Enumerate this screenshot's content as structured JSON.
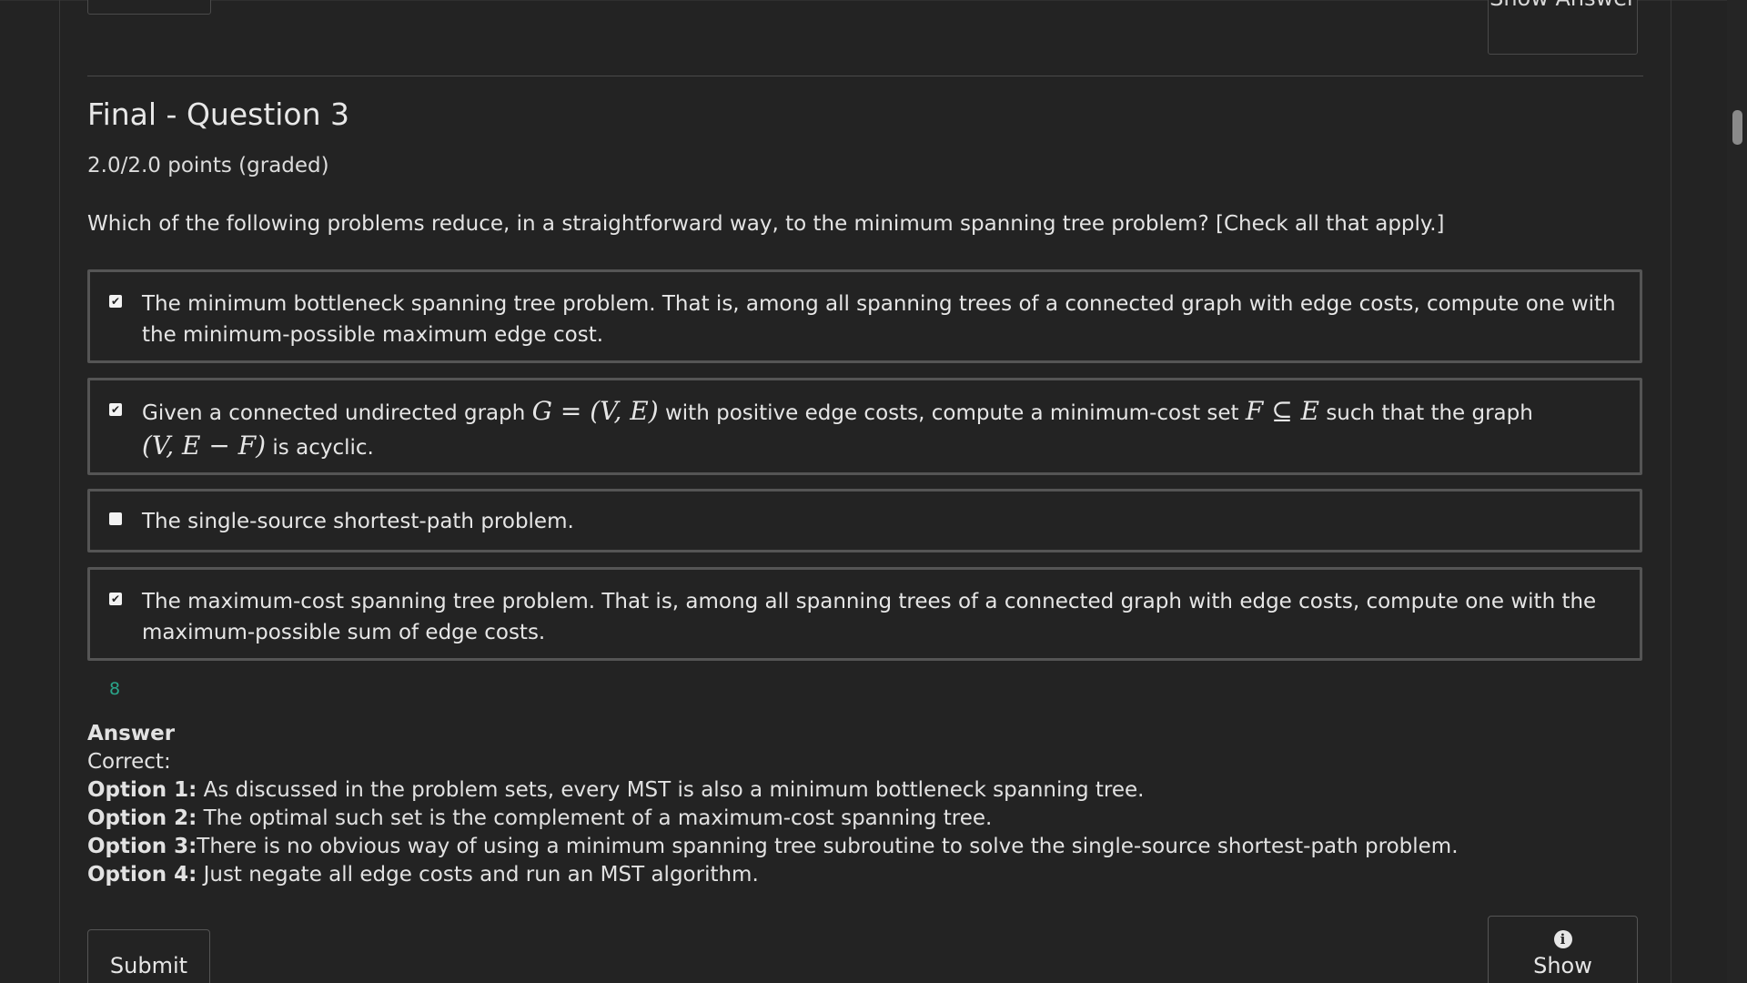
{
  "previous": {
    "show_answer_label": "Show Answer"
  },
  "question": {
    "title": "Final - Question 3",
    "points": "2.0/2.0 points (graded)",
    "prompt": "Which of the following problems reduce, in a straightforward way, to the minimum spanning tree problem? [Check all that apply.]",
    "options": [
      {
        "checked": true,
        "text": "The minimum bottleneck spanning tree problem. That is, among all spanning trees of a connected graph with edge costs, compute one with the minimum-possible maximum edge cost."
      },
      {
        "checked": true,
        "text_a": "Given a connected undirected graph ",
        "math_a": "G = (V, E)",
        "text_b": " with positive edge costs, compute a minimum-cost set ",
        "math_b": "F ⊆ E",
        "text_c": " such that the graph ",
        "math_c": "(V, E − F)",
        "text_d": " is acyclic."
      },
      {
        "checked": false,
        "text": "The single-source shortest-path problem."
      },
      {
        "checked": true,
        "text": "The maximum-cost spanning tree problem. That is, among all spanning trees of a connected graph with edge costs, compute one with the maximum-possible sum of edge costs."
      }
    ],
    "count": "8"
  },
  "answer": {
    "heading": "Answer",
    "correct_label": "Correct:",
    "explanations": [
      {
        "label": "Option 1:",
        "text": " As discussed in the problem sets, every MST is also a minimum bottleneck spanning tree."
      },
      {
        "label": "Option 2:",
        "text": " The optimal such set is the complement of a maximum-cost spanning tree."
      },
      {
        "label": "Option 3:",
        "text": "There is no obvious way of using a minimum spanning tree subroutine to solve the single-source shortest-path problem."
      },
      {
        "label": "Option 4:",
        "text": " Just negate all edge costs and run an MST algorithm."
      }
    ]
  },
  "actions": {
    "submit_label": "Submit",
    "show_label": "Show",
    "show_icon": "info-icon"
  }
}
